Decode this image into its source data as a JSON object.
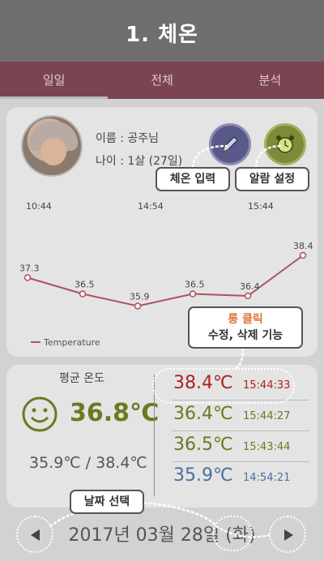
{
  "header": {
    "title": "1. 체온"
  },
  "tabs": [
    {
      "label": "일일",
      "active": true
    },
    {
      "label": "전체",
      "active": false
    },
    {
      "label": "분석",
      "active": false
    }
  ],
  "profile": {
    "name_line": "이름 : 공주님",
    "age_line": "나이 : 1살 (27일)"
  },
  "callouts": {
    "input": "체온 입력",
    "alarm": "알람 설정",
    "long_click_title": "롱 클릭",
    "long_click_desc": "수정, 삭제 기능",
    "date_select": "날짜 선택"
  },
  "chart_data": {
    "type": "line",
    "x_top_labels": [
      "10:44",
      "14:54",
      "15:44"
    ],
    "x": [
      "10:44",
      "",
      "14:54",
      "",
      "15:44",
      ""
    ],
    "series": [
      {
        "name": "Temperature",
        "values": [
          37.3,
          36.5,
          35.9,
          36.5,
          36.4,
          38.4
        ],
        "color": "#b0505e"
      }
    ],
    "data_labels": [
      "37.3",
      "36.5",
      "35.9",
      "36.5",
      "36.4",
      "38.4"
    ],
    "ylim": [
      35.0,
      39.0
    ],
    "legend": "bottom-left",
    "grid": false
  },
  "summary": {
    "title": "평균 온도",
    "average": "36.8℃",
    "minmax": "35.9℃ / 38.4℃",
    "average_color": "#6b7a1e"
  },
  "records": [
    {
      "value": "38.4℃",
      "time": "15:44:33",
      "color": "#b02020"
    },
    {
      "value": "36.4℃",
      "time": "15:44:27",
      "color": "#6b7a1e"
    },
    {
      "value": "36.5℃",
      "time": "15:43:44",
      "color": "#6b7a1e"
    },
    {
      "value": "35.9℃",
      "time": "14:54:21",
      "color": "#4a6fa0"
    }
  ],
  "date": {
    "text": "2017년 03월 28일 (화)"
  },
  "icons": {
    "pencil": "pencil-icon",
    "alarm": "alarm-clock-icon",
    "prev": "triangle-left-icon",
    "next": "triangle-right-icon",
    "smile": "smiley-face-icon"
  }
}
